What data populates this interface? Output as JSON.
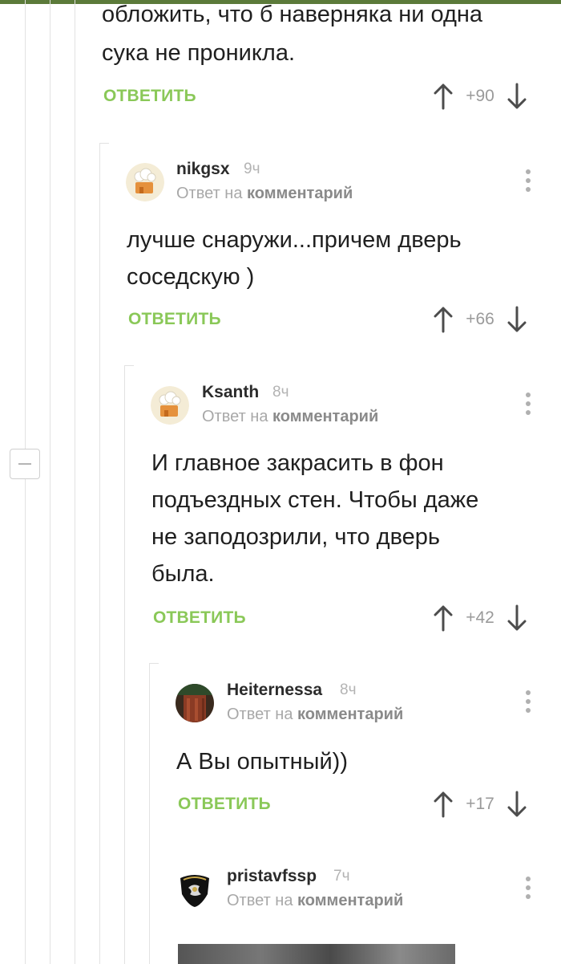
{
  "colors": {
    "accent": "#8ac858",
    "topbar": "#5b7a3a"
  },
  "comments": [
    {
      "text_lines": [
        "обложить, что б наверняка ни одна",
        "сука не проникла."
      ],
      "reply_label": "ОТВЕТИТЬ",
      "score": "+90"
    },
    {
      "username": "nikgsx",
      "time": "9ч",
      "reply_prefix": "Ответ на",
      "reply_target": "комментарий",
      "text_lines": [
        "лучше снаружи...причем дверь",
        "соседскую )"
      ],
      "reply_label": "ОТВЕТИТЬ",
      "score": "+66"
    },
    {
      "username": "Ksanth",
      "time": "8ч",
      "reply_prefix": "Ответ на",
      "reply_target": "комментарий",
      "text_lines": [
        "И главное закрасить в фон",
        "подъездных стен. Чтобы даже",
        "не заподозрили, что дверь",
        "была."
      ],
      "reply_label": "ОТВЕТИТЬ",
      "score": "+42"
    },
    {
      "username": "Heiternessa",
      "time": "8ч",
      "reply_prefix": "Ответ на",
      "reply_target": "комментарий",
      "text_lines": [
        "А Вы опытный))"
      ],
      "reply_label": "ОТВЕТИТЬ",
      "score": "+17"
    },
    {
      "username": "pristavfssp",
      "time": "7ч",
      "reply_prefix": "Ответ на",
      "reply_target": "комментарий"
    }
  ]
}
